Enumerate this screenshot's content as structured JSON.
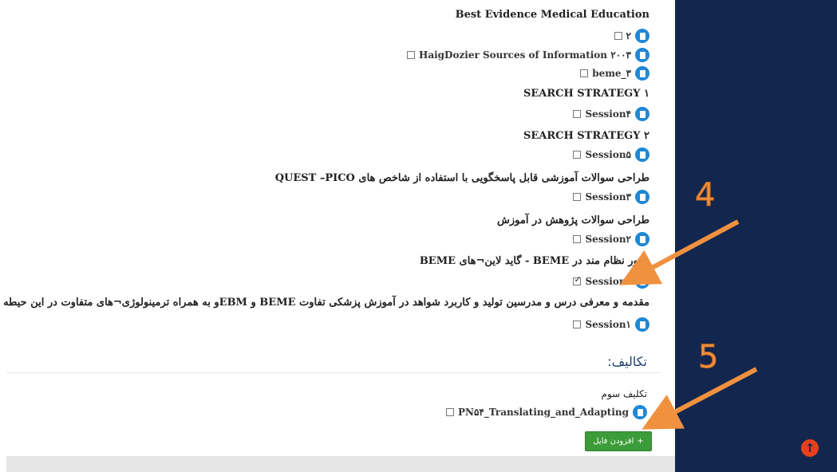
{
  "materials": [
    {
      "kind": "heading",
      "text": "Best Evidence Medical Education"
    },
    {
      "kind": "file",
      "label": "۲",
      "checked": false
    },
    {
      "kind": "file",
      "label": "HaigDozier Sources of Information ۲۰۰۳",
      "checked": false
    },
    {
      "kind": "file",
      "label": "beme_۳",
      "checked": false
    },
    {
      "kind": "heading",
      "text": "SEARCH STRATEGY ۱"
    },
    {
      "kind": "file",
      "label": "Session۴",
      "checked": false
    },
    {
      "kind": "heading",
      "text": "SEARCH STRATEGY ۲"
    },
    {
      "kind": "file",
      "label": "Session۵",
      "checked": false
    },
    {
      "kind": "heading",
      "text": "طراحی سوالات آموزشی قابل پاسخگویی با استفاده از شاخص های QUEST –PICO"
    },
    {
      "kind": "file",
      "label": "Session۳",
      "checked": false
    },
    {
      "kind": "heading",
      "text": "طراحی سوالات پژوهش در آموزش"
    },
    {
      "kind": "file",
      "label": "Session۲",
      "checked": false
    },
    {
      "kind": "heading",
      "text": "مرور نظام مند در BEME - گاید لاین¬های BEME"
    },
    {
      "kind": "file",
      "label": "Session۶",
      "checked": true
    },
    {
      "kind": "heading",
      "text": "مقدمه و معرفی درس و مدرسین تولید و کاربرد شواهد در آموزش پزشکی تفاوت BEME و EBMو به همراه ترمینولوژی¬های متفاوت در این حیطه"
    },
    {
      "kind": "file",
      "label": "Session۱",
      "checked": false
    }
  ],
  "assignments_title": "تکالیف:",
  "assignment": {
    "heading": "تکلیف سوم",
    "file_label": "PN۵۴_Translating_and_Adapting",
    "file_checked": false
  },
  "add_file_button": {
    "label": "افزودن فایل",
    "icon": "plus-icon"
  },
  "scroll_top_icon": "arrow-up-circle-icon",
  "annotations": [
    "4",
    "5"
  ],
  "colors": {
    "sidebar": "#13264e",
    "accent_orange": "#f0913f",
    "file_icon": "#1e88d6",
    "button_green": "#3c9c3a"
  }
}
